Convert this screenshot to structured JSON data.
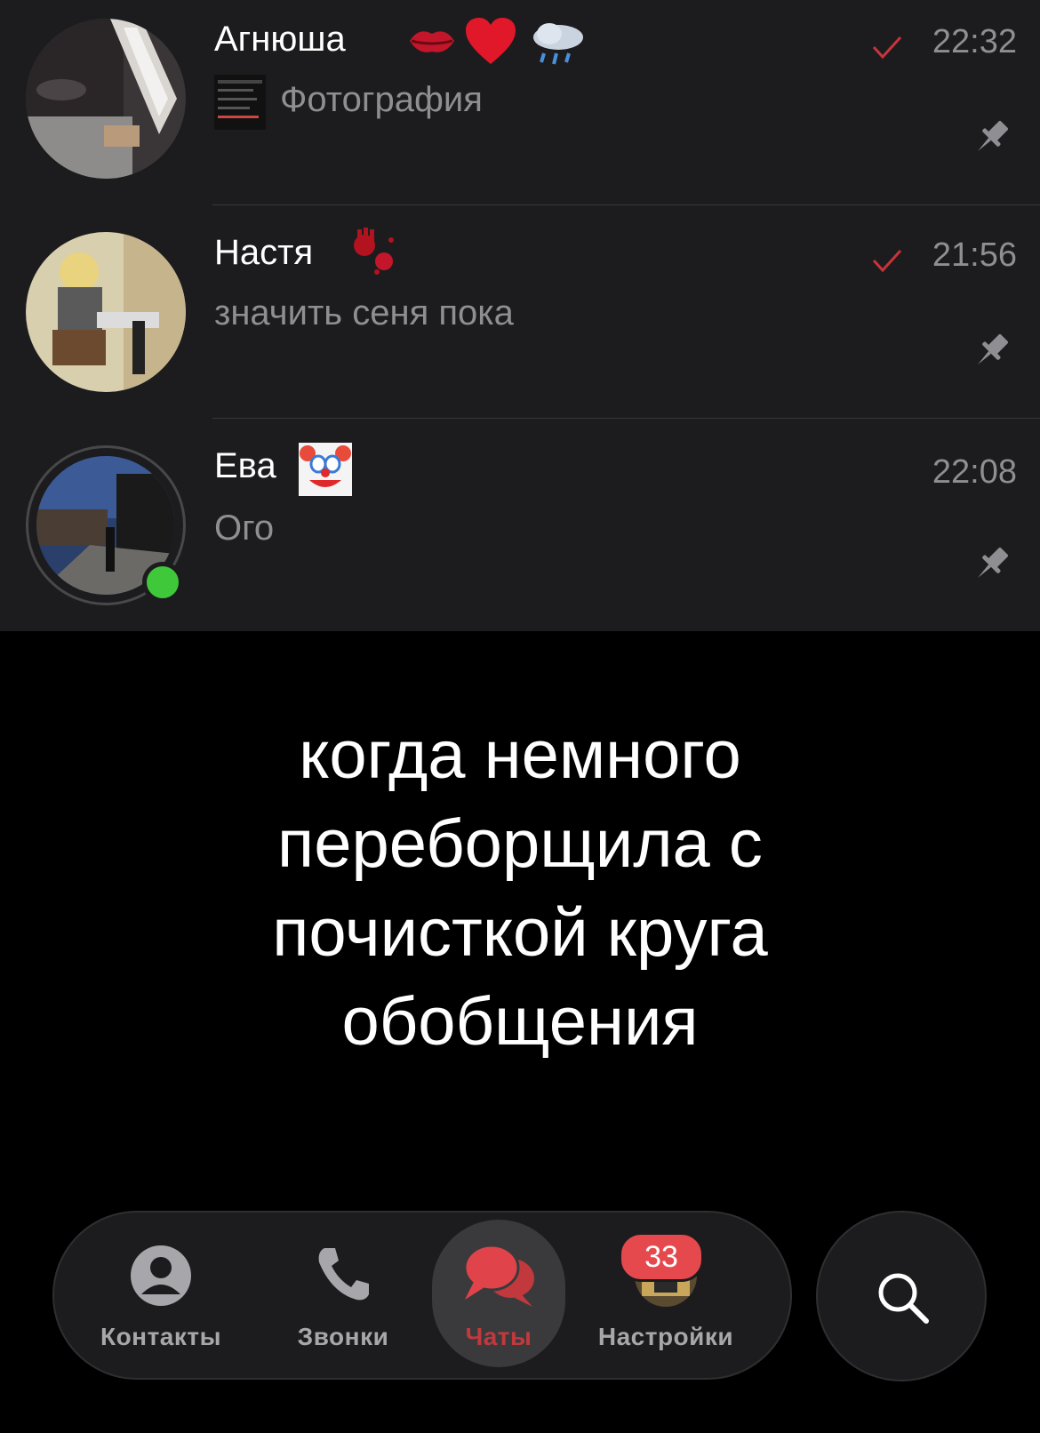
{
  "chats": [
    {
      "name": "Агнюша",
      "preview": "Фотография",
      "time": "22:32",
      "read": true,
      "pinned": true,
      "emojis": [
        "kiss-mark-icon",
        "red-heart-icon",
        "rain-cloud-icon"
      ]
    },
    {
      "name": "Настя",
      "preview": "значить сеня пока",
      "time": "21:56",
      "read": true,
      "pinned": true,
      "emojis": [
        "bloody-hand-icon"
      ]
    },
    {
      "name": "Ева",
      "preview": "Ого",
      "time": "22:08",
      "read": false,
      "pinned": true,
      "online": true,
      "emojis": [
        "clown-face-icon"
      ]
    }
  ],
  "caption": {
    "lines": [
      "когда немного",
      "переборщила с",
      "почисткой круга",
      "обобщения"
    ]
  },
  "tabbar": {
    "tabs": [
      {
        "label": "Контакты",
        "icon": "person-circle-icon"
      },
      {
        "label": "Звонки",
        "icon": "phone-icon"
      },
      {
        "label": "Чаты",
        "icon": "chat-bubbles-icon",
        "active": true
      },
      {
        "label": "Настройки",
        "icon": "avatar-icon",
        "badge": "33"
      }
    ],
    "search_icon": "search-icon"
  },
  "colors": {
    "accent": "#e6494d",
    "active_tab_text": "#c2393d",
    "online": "#3ec83a",
    "check": "#c8343a"
  }
}
